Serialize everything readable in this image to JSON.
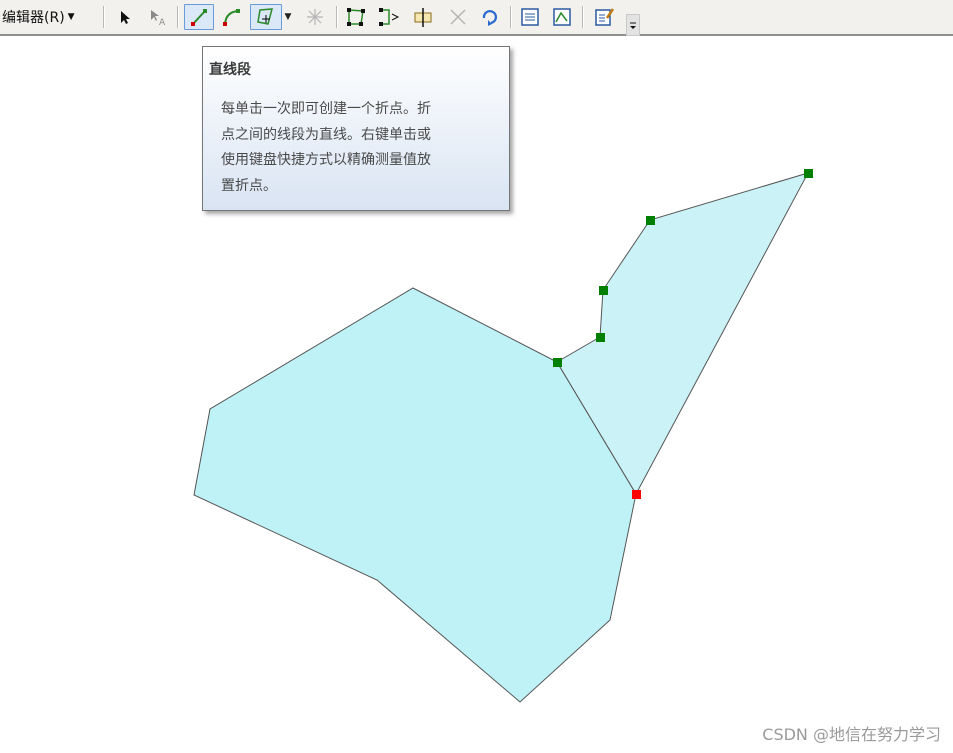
{
  "toolbar": {
    "editor_menu_label": "编辑器(R)",
    "buttons": [
      {
        "icon": "edit-tool-arrow-icon"
      },
      {
        "icon": "annotation-edit-tool-icon"
      },
      {
        "icon": "straight-segment-icon",
        "active": true
      },
      {
        "icon": "arc-segment-icon"
      },
      {
        "icon": "construction-tools-icon",
        "active": true
      },
      {
        "icon": "cut-polygons-tool-icon"
      },
      {
        "icon": "edit-vertices-icon"
      },
      {
        "icon": "reshape-feature-icon"
      },
      {
        "icon": "split-tool-icon"
      },
      {
        "icon": "intersection-icon"
      },
      {
        "icon": "rotate-tool-icon"
      },
      {
        "icon": "attributes-icon"
      },
      {
        "icon": "sketch-properties-icon"
      },
      {
        "icon": "create-features-icon"
      },
      {
        "icon": "toolbar-options-icon"
      }
    ]
  },
  "tooltip": {
    "title": "直线段",
    "lines": [
      "每单击一次即可创建一个折点。折",
      "点之间的线段为直线。右键单击或",
      "使用键盘快捷方式以精确测量值放",
      "置折点。"
    ]
  },
  "map": {
    "polygon_fill": "#bff2f6",
    "sketch_fill": "#cbf3f7",
    "outline_color": "#555555",
    "vertex_color": "#008000",
    "current_vertex_color": "#ff0000"
  },
  "watermark": "CSDN @地信在努力学习"
}
